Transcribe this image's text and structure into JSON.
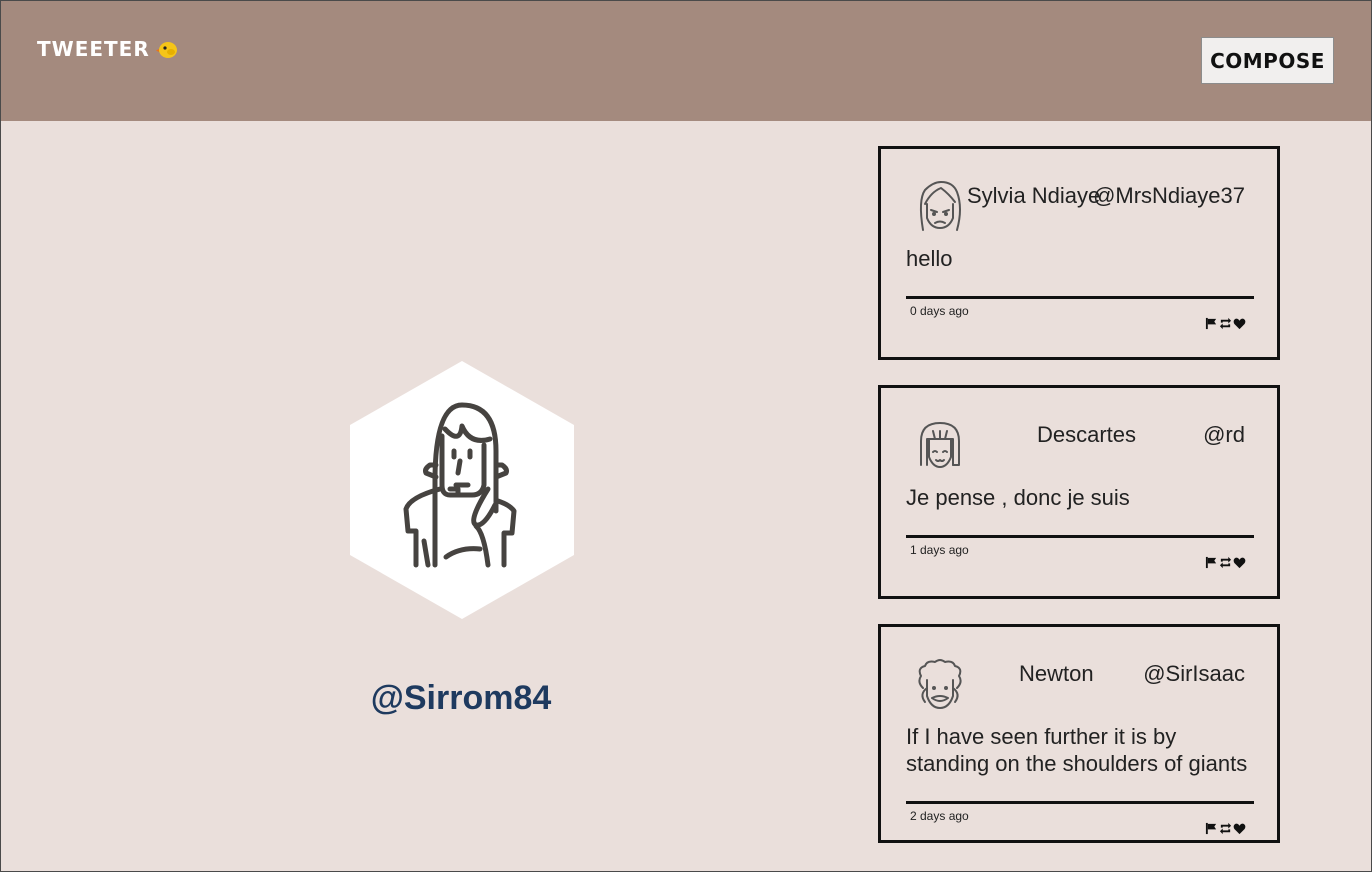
{
  "header": {
    "brand": "TWEETER",
    "brand_icon": "chick-icon",
    "compose_label": "COMPOSE"
  },
  "profile": {
    "handle": "@Sirrom84",
    "avatar_icon": "woman-avatar-icon"
  },
  "tweets": [
    {
      "name": "Sylvia Ndiaye",
      "handle": "@MrsNdiaye37",
      "body": "hello",
      "time": "0 days ago",
      "avatar_icon": "sad-woman-avatar-icon"
    },
    {
      "name": "Descartes",
      "handle": "@rd",
      "body": "Je pense , donc je suis",
      "time": "1 days ago",
      "avatar_icon": "smiling-girl-avatar-icon"
    },
    {
      "name": "Newton",
      "handle": "@SirIsaac",
      "body": "If I have seen further it is by standing on the shoulders of giants",
      "time": "2 days ago",
      "avatar_icon": "curly-haired-man-avatar-icon"
    }
  ],
  "actions": [
    "flag-icon",
    "retweet-icon",
    "heart-icon"
  ],
  "colors": {
    "header_bg": "#a48a7e",
    "page_bg": "#eadfdb",
    "handle_color": "#1e3a5f"
  }
}
